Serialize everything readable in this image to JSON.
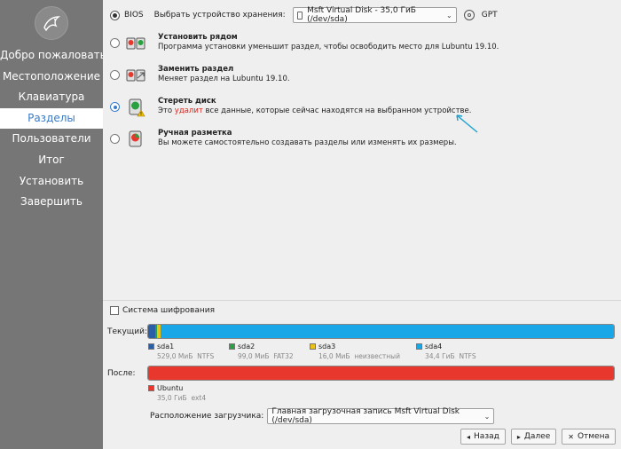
{
  "sidebar": {
    "items": [
      {
        "label": "Добро пожаловать",
        "active": false
      },
      {
        "label": "Местоположение",
        "active": false
      },
      {
        "label": "Клавиатура",
        "active": false
      },
      {
        "label": "Разделы",
        "active": true
      },
      {
        "label": "Пользователи",
        "active": false
      },
      {
        "label": "Итог",
        "active": false
      },
      {
        "label": "Установить",
        "active": false
      },
      {
        "label": "Завершить",
        "active": false
      }
    ]
  },
  "header": {
    "bios_label": "BIOS",
    "device_label": "Выбрать устройство хранения:",
    "device_value": "Msft Virtual Disk - 35,0 ГиБ (/dev/sda)",
    "gpt_label": "GPT"
  },
  "options": [
    {
      "title": "Установить рядом",
      "desc": "Программа установки уменьшит раздел, чтобы освободить место для Lubuntu 19.10.",
      "checked": false
    },
    {
      "title": "Заменить раздел",
      "desc": "Меняет раздел на Lubuntu 19.10.",
      "checked": false
    },
    {
      "title": "Стереть диск",
      "desc_before": "Это ",
      "desc_red": "удалит",
      "desc_after": " все данные, которые сейчас находятся на выбранном устройстве.",
      "checked": true
    },
    {
      "title": "Ручная разметка",
      "desc": "Вы можете самостоятельно создавать разделы или изменять их размеры.",
      "checked": false
    }
  ],
  "encryption_label": "Система шифрования",
  "current_label": "Текущий:",
  "after_label": "После:",
  "current_partitions": [
    {
      "name": "sda1",
      "size": "529,0 МиБ",
      "fs": "NTFS",
      "color": "#2a5fa8",
      "fraction": 0.0148
    },
    {
      "name": "sda2",
      "size": "99,0 МиБ",
      "fs": "FAT32",
      "color": "#2aa040",
      "fraction": 0.0028
    },
    {
      "name": "sda3",
      "size": "16,0 МиБ",
      "fs": "неизвестный",
      "color": "#e8c21a",
      "fraction": 0.0045
    },
    {
      "name": "sda4",
      "size": "34,4 ГиБ",
      "fs": "NTFS",
      "color": "#1aa7e8",
      "fraction": 0.978
    }
  ],
  "after_partitions": [
    {
      "name": "Ubuntu",
      "size": "35,0 ГиБ",
      "fs": "ext4",
      "color": "#e8382d",
      "fraction": 1.0
    }
  ],
  "bootloader_label": "Расположение загрузчика:",
  "bootloader_value": "Главная загрузочная запись Msft Virtual Disk (/dev/sda)",
  "buttons": {
    "back": "Назад",
    "next": "Далее",
    "cancel": "Отмена"
  }
}
